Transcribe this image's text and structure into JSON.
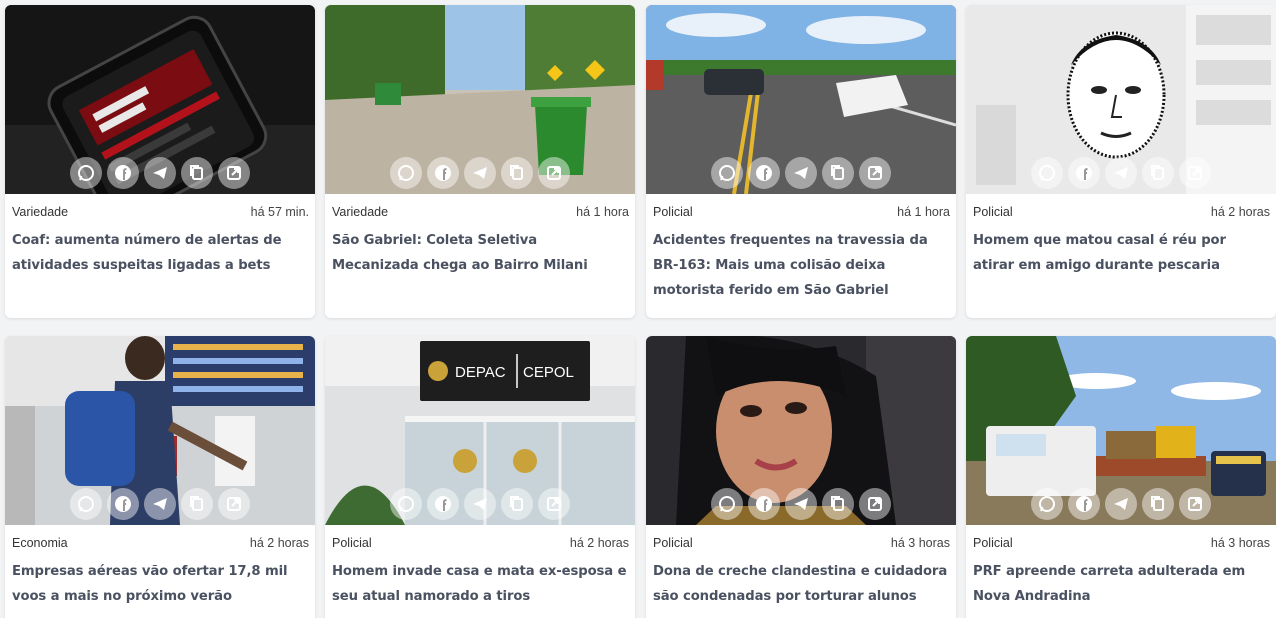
{
  "share_icons": [
    "whatsapp-icon",
    "facebook-icon",
    "telegram-icon",
    "copy-icon",
    "external-link-icon"
  ],
  "cards": [
    {
      "category": "Variedade",
      "time": "há 57 min.",
      "title": "Coaf: aumenta número de alertas de atividades suspeitas ligadas a bets"
    },
    {
      "category": "Variedade",
      "time": "há 1 hora",
      "title": "São Gabriel: Coleta Seletiva Mecanizada chega ao Bairro Milani"
    },
    {
      "category": "Policial",
      "time": "há 1 hora",
      "title": "Acidentes frequentes na travessia da BR-163: Mais uma colisão deixa motorista ferido em São Gabriel"
    },
    {
      "category": "Policial",
      "time": "há 2 horas",
      "title": "Homem que matou casal é réu por atirar em amigo durante pescaria"
    },
    {
      "category": "Economia",
      "time": "há 2 horas",
      "title": "Empresas aéreas vão ofertar 17,8 mil voos a mais no próximo verão"
    },
    {
      "category": "Policial",
      "time": "há 2 horas",
      "title": "Homem invade casa e mata ex-esposa e seu atual namorado a tiros"
    },
    {
      "category": "Policial",
      "time": "há 3 horas",
      "title": "Dona de creche clandestina e cuidadora são condenadas por torturar alunos"
    },
    {
      "category": "Policial",
      "time": "há 3 horas",
      "title": "PRF apreende carreta adulterada em Nova Andradina"
    }
  ],
  "sign_text": {
    "left": "DEPAC",
    "right": "CEPOL"
  }
}
